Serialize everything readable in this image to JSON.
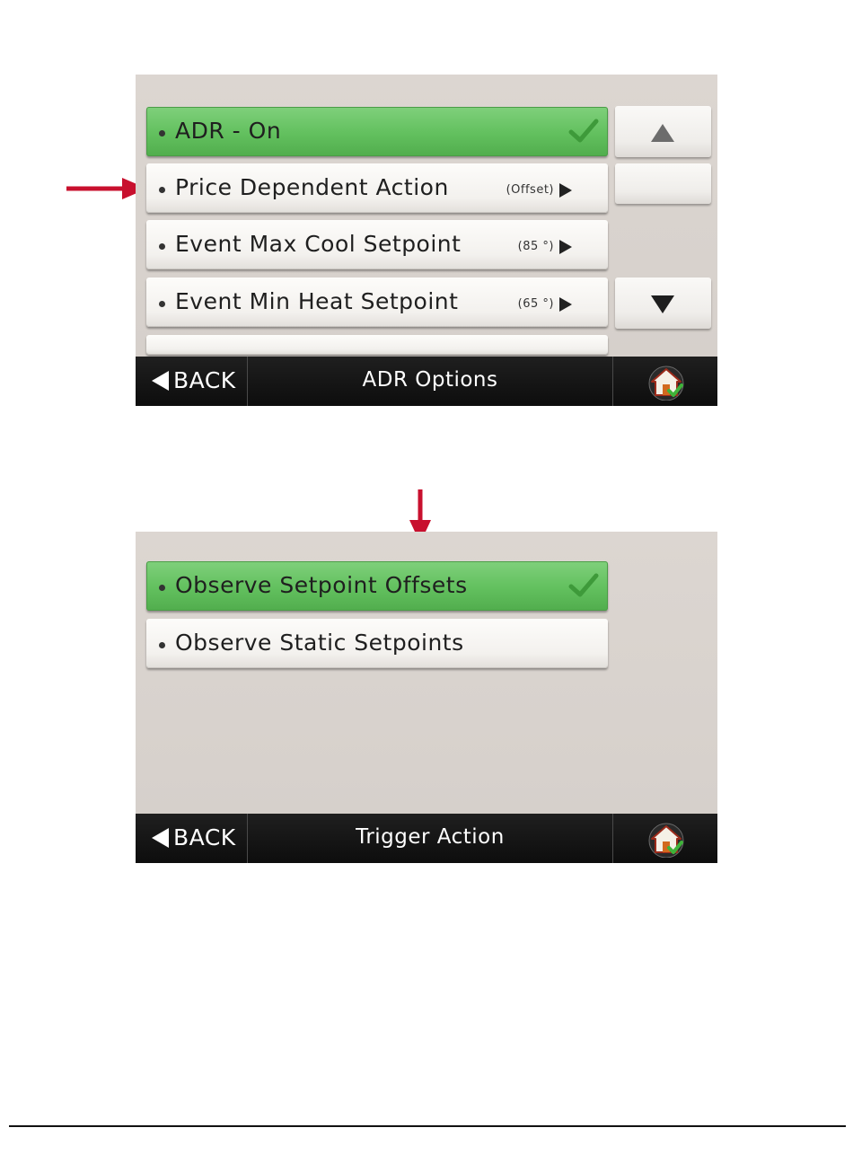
{
  "screen1": {
    "items": [
      {
        "label": "ADR - On",
        "value": "",
        "selected": true
      },
      {
        "label": "Price Dependent Action",
        "value": "(Offset)",
        "selected": false
      },
      {
        "label": "Event Max Cool Setpoint",
        "value": "(85 °)",
        "selected": false
      },
      {
        "label": "Event Min Heat Setpoint",
        "value": "(65 °)",
        "selected": false
      }
    ],
    "back_label": "BACK",
    "title": "ADR Options"
  },
  "screen2": {
    "items": [
      {
        "label": "Observe Setpoint Offsets",
        "selected": true
      },
      {
        "label": "Observe Static Setpoints",
        "selected": false
      }
    ],
    "back_label": "BACK",
    "title": "Trigger Action"
  },
  "colors": {
    "selected_green": "#62c05e",
    "checkmark_green": "#3e9a3a",
    "callout_arrow_red": "#c8102e",
    "bottom_bar": "#111111"
  },
  "icons": {
    "check": "check-icon",
    "home": "home-icon",
    "scroll_up": "triangle-up-icon",
    "scroll_down": "triangle-down-icon",
    "back": "triangle-left-icon",
    "submenu": "triangle-right-icon"
  }
}
